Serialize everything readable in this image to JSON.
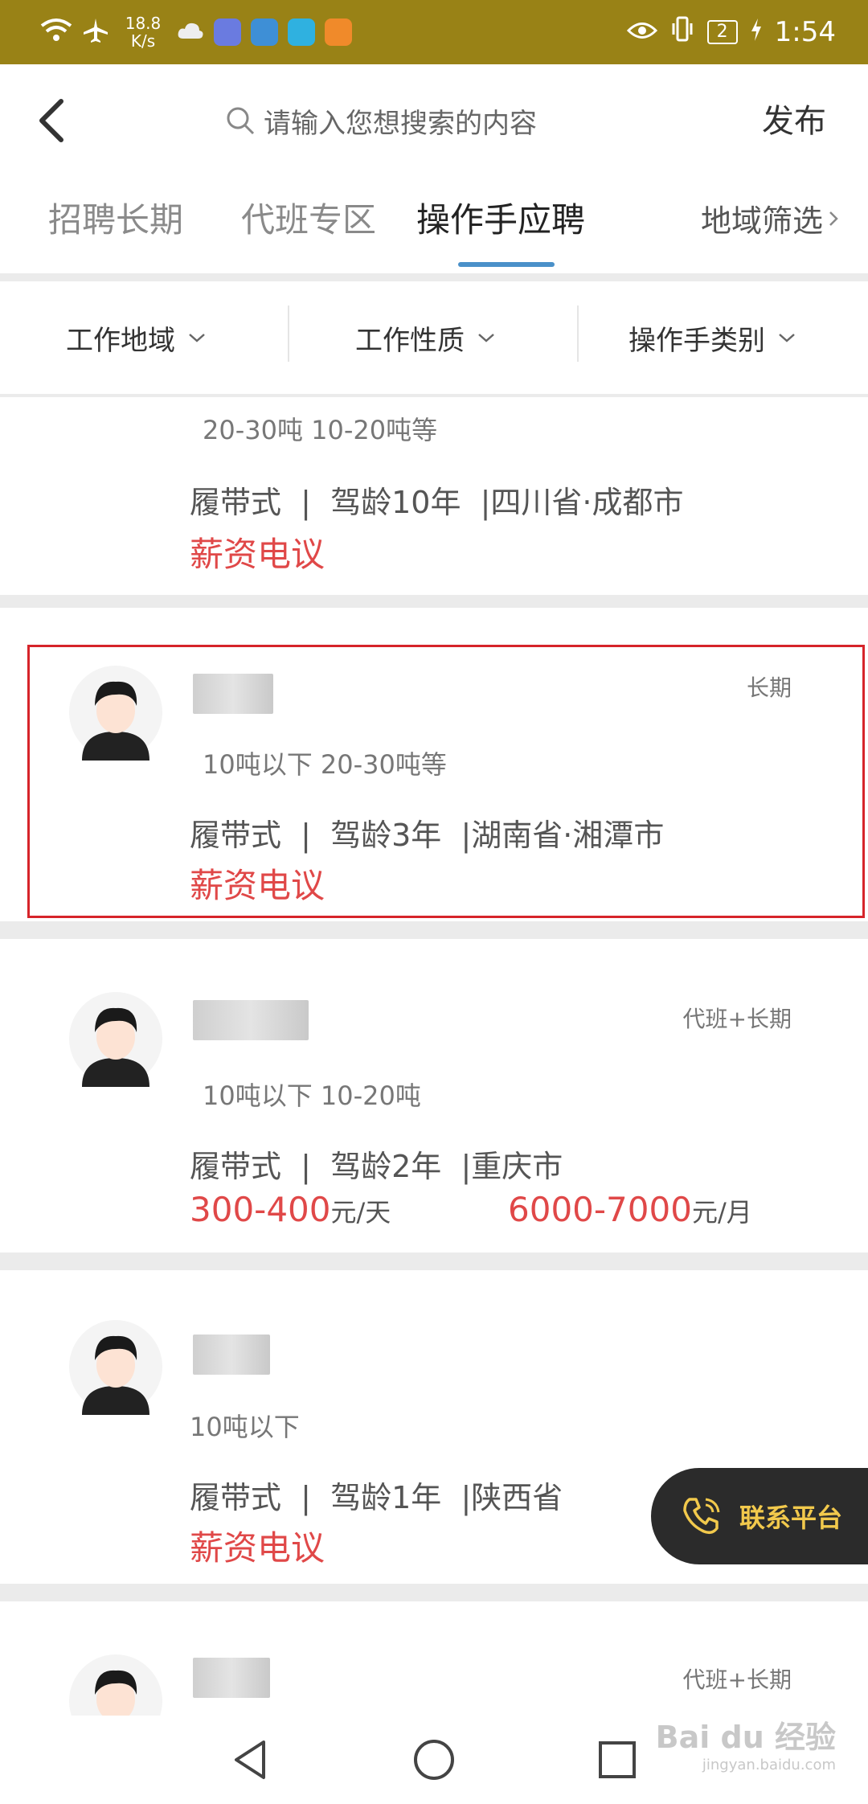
{
  "status_bar": {
    "speed_value": "18.8",
    "speed_unit": "K/s",
    "sim": "2",
    "time": "1:54"
  },
  "header": {
    "search_placeholder": "请输入您想搜索的内容",
    "publish_label": "发布"
  },
  "tabs": [
    {
      "label": "招聘长期"
    },
    {
      "label": "代班专区"
    },
    {
      "label": "操作手应聘"
    },
    {
      "label": "地域筛选"
    }
  ],
  "filters": [
    {
      "label": "工作地域"
    },
    {
      "label": "工作性质"
    },
    {
      "label": "操作手类别"
    }
  ],
  "cards": [
    {
      "tonnage": "20-30吨  10-20吨等",
      "detail": "履带式  |  驾龄10年  |四川省·成都市",
      "salary": "薪资电议"
    },
    {
      "tag": "长期",
      "tonnage": "10吨以下  20-30吨等",
      "detail": "履带式  |  驾龄3年  |湖南省·湘潭市",
      "salary": "薪资电议"
    },
    {
      "tag": "代班+长期",
      "tonnage": "10吨以下  10-20吨",
      "detail": "履带式  |  驾龄2年  |重庆市",
      "price_day": "300-400",
      "price_day_unit": "元/天",
      "price_month": "6000-7000",
      "price_month_unit": "元/月"
    },
    {
      "tonnage": "10吨以下",
      "detail": "履带式  |  驾龄1年  |陕西省",
      "salary": "薪资电议"
    },
    {
      "tag": "代班+长期"
    }
  ],
  "contact_label": "联系平台",
  "watermark": {
    "main": "Bai du 经验",
    "sub": "jingyan.baidu.com"
  },
  "colors": {
    "status_bar": "#998216",
    "accent_red": "#e04848",
    "tab_underline": "#4a90c9",
    "highlight_box": "#d6242a",
    "contact_bg": "#2b2b2b",
    "contact_text": "#f2c94c"
  }
}
